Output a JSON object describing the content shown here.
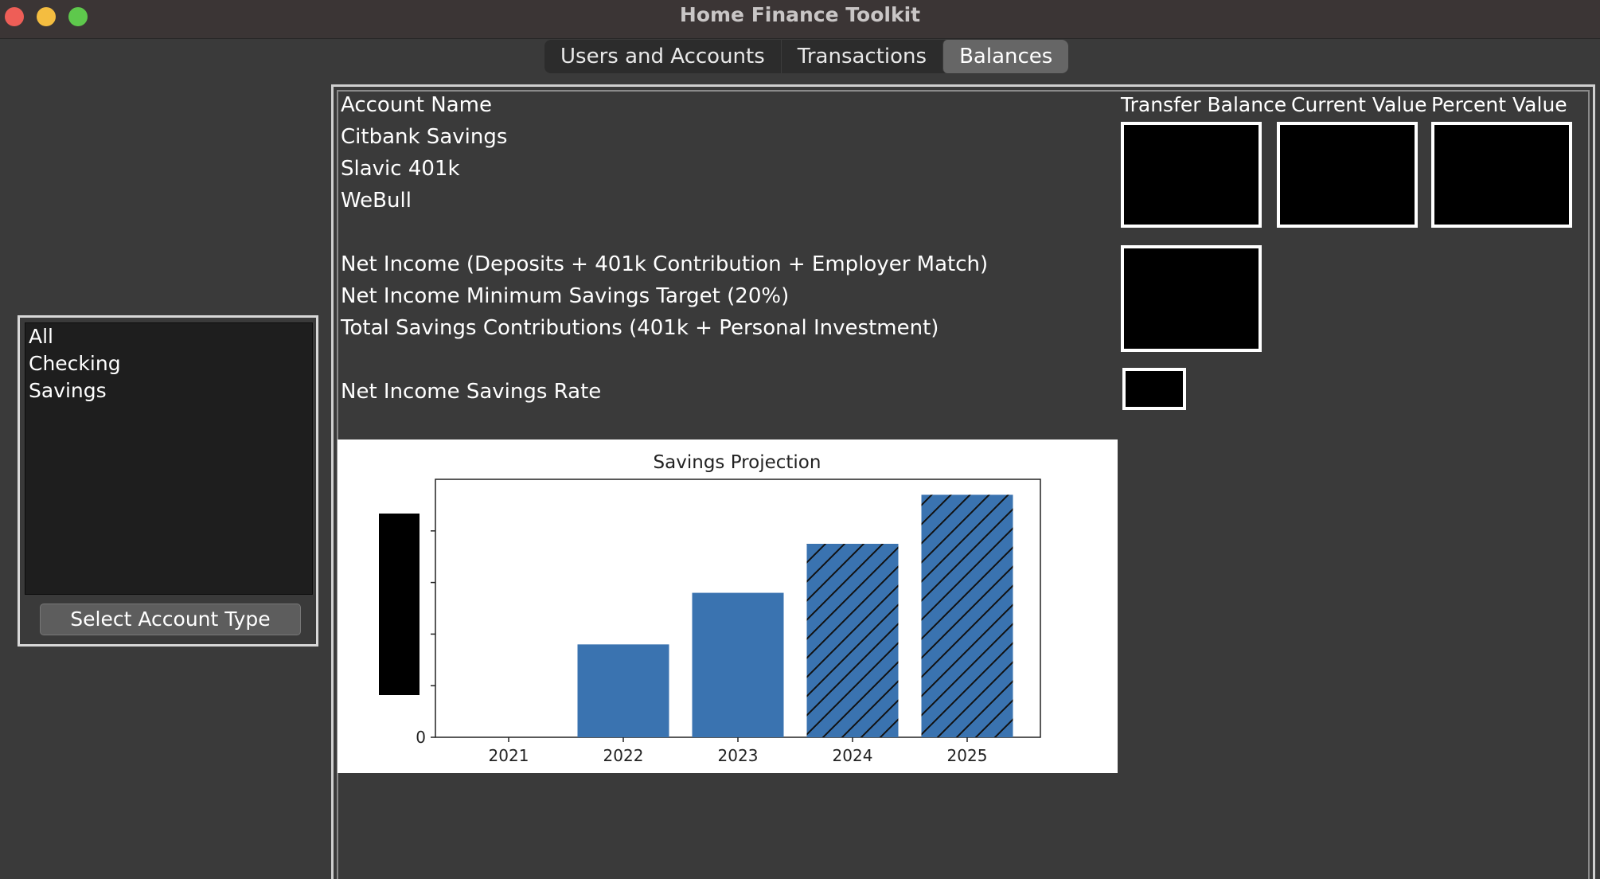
{
  "window": {
    "title": "Home Finance Toolkit"
  },
  "tabs": [
    {
      "label": "Users and Accounts",
      "active": false
    },
    {
      "label": "Transactions",
      "active": false
    },
    {
      "label": "Balances",
      "active": true
    }
  ],
  "account_types": {
    "items": [
      "All",
      "Checking",
      "Savings"
    ],
    "button_label": "Select Account Type"
  },
  "balances": {
    "header_account": "Account Name",
    "columns": [
      "Transfer Balance",
      "Current Value",
      "Percent Value"
    ],
    "accounts": [
      "Citbank Savings",
      "Slavic 401k",
      "WeBull"
    ],
    "income_labels": [
      "Net Income (Deposits + 401k Contribution + Employer Match)",
      "Net Income Minimum Savings Target (20%)",
      "Total Savings Contributions (401k + Personal Investment)"
    ],
    "rate_label": "Net Income Savings Rate"
  },
  "colors": {
    "bar": "#3a73b0",
    "background": "#3a3a3a",
    "title_bar": "#3b3535"
  },
  "chart_data": {
    "type": "bar",
    "title": "Savings Projection",
    "categories": [
      "2021",
      "2022",
      "2023",
      "2024",
      "2025"
    ],
    "values": [
      0,
      1.8,
      2.8,
      3.75,
      4.7
    ],
    "projected": [
      false,
      false,
      false,
      true,
      true
    ],
    "y_tick_labels": [
      "0"
    ],
    "ylim": [
      0,
      5.0
    ],
    "xlabel": "",
    "ylabel": ""
  }
}
